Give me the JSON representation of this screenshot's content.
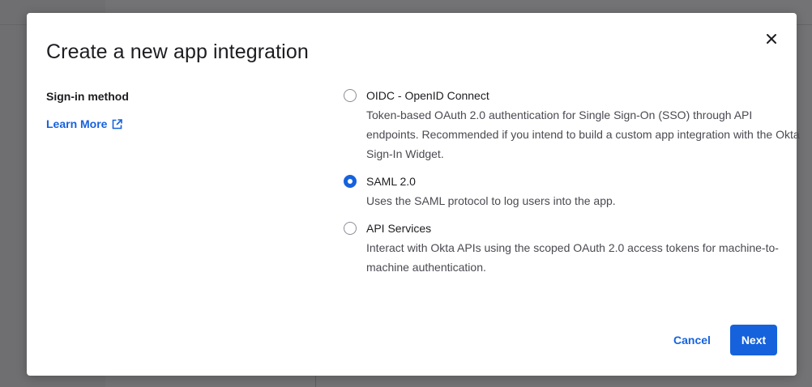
{
  "dialog": {
    "title": "Create a new app integration",
    "close_icon": "close-icon"
  },
  "sign_in_method": {
    "label": "Sign-in method",
    "learn_more": "Learn More",
    "learn_more_icon": "external-link-icon",
    "selected": "SAML 2.0",
    "options": [
      {
        "title": "OIDC - OpenID Connect",
        "description": "Token-based OAuth 2.0 authentication for Single Sign-On (SSO) through API endpoints. Recommended if you intend to build a custom app integration with the Okta Sign-In Widget.",
        "checked": false
      },
      {
        "title": "SAML 2.0",
        "description": "Uses the SAML protocol to log users into the app.",
        "checked": true
      },
      {
        "title": "API Services",
        "description": "Interact with Okta APIs using the scoped OAuth 2.0 access tokens for machine-to-machine authentication.",
        "checked": false
      }
    ]
  },
  "footer": {
    "cancel_label": "Cancel",
    "next_label": "Next"
  },
  "colors": {
    "accent": "#1662dd",
    "overlay": "#6f6f71",
    "text": "#1d1d21",
    "muted_text": "#4a4a52"
  }
}
